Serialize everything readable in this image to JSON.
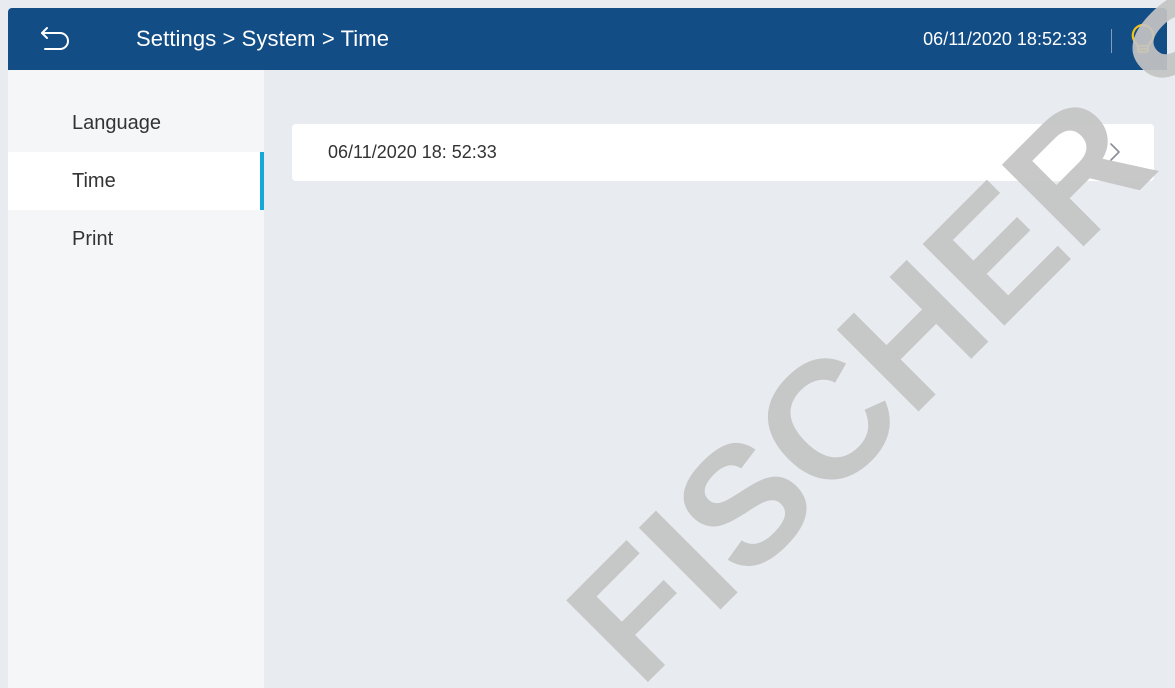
{
  "header": {
    "breadcrumb": "Settings > System > Time",
    "datetime": "06/11/2020 18:52:33",
    "back_icon": "back-arrow-icon",
    "light_icon": "lightbulb-icon"
  },
  "sidebar": {
    "items": [
      {
        "label": "Language",
        "active": false
      },
      {
        "label": "Time",
        "active": true
      },
      {
        "label": "Print",
        "active": false
      }
    ]
  },
  "main": {
    "time_setting_value": "06/11/2020 18: 52:33",
    "chevron_icon": "chevron-right-icon"
  },
  "watermark": "FISCHER SA",
  "colors": {
    "header_bg": "#134d86",
    "active_indicator": "#16a9d8",
    "bulb_icon": "#f2c318",
    "content_bg": "#e8ebef",
    "watermark": "#c4c4c4"
  }
}
